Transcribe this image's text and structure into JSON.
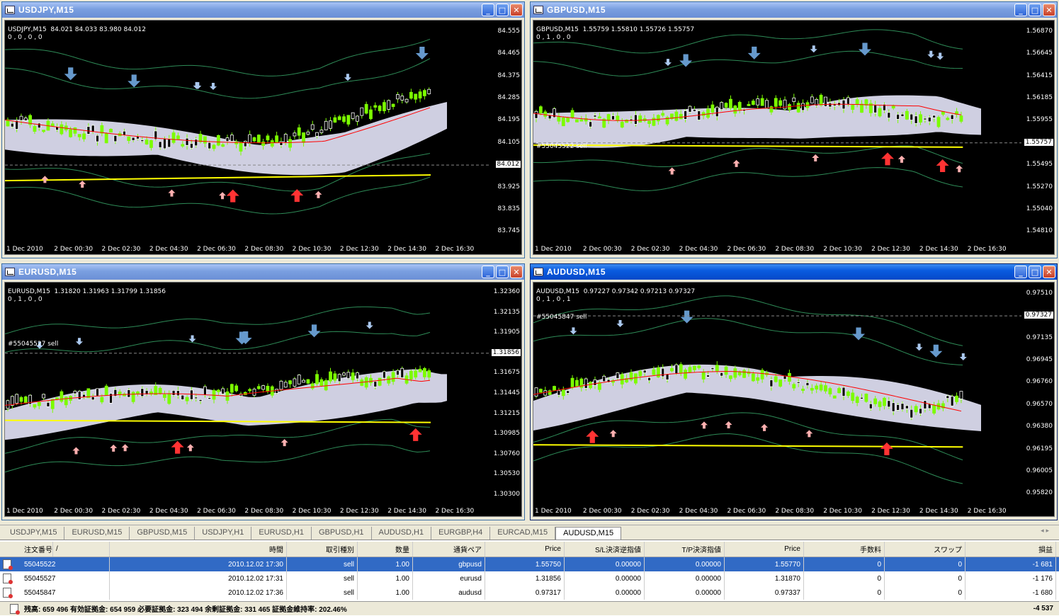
{
  "windows": [
    {
      "id": "usdjpy",
      "title": "USDJPY,M15",
      "info_line1": "USDJPY,M15  84.021 84.033 83.980 84.012",
      "info_line2": "0 , 0 , 0 , 0",
      "price_ticks": [
        "84.555",
        "84.465",
        "84.375",
        "84.285",
        "84.195",
        "84.105",
        "84.012",
        "83.925",
        "83.835",
        "83.745"
      ],
      "current_price": "84.012",
      "order_label": "",
      "time_ticks": [
        "1 Dec 2010",
        "2 Dec 00:30",
        "2 Dec 02:30",
        "2 Dec 04:30",
        "2 Dec 06:30",
        "2 Dec 08:30",
        "2 Dec 10:30",
        "2 Dec 12:30",
        "2 Dec 14:30",
        "2 Dec 16:30"
      ]
    },
    {
      "id": "gbpusd",
      "title": "GBPUSD,M15",
      "info_line1": "GBPUSD,M15  1.55759 1.55810 1.55726 1.55757",
      "info_line2": "0 , 1 , 0 , 0",
      "price_ticks": [
        "1.56870",
        "1.56645",
        "1.56415",
        "1.56185",
        "1.55955",
        "1.55757",
        "1.55495",
        "1.55270",
        "1.55040",
        "1.54810"
      ],
      "current_price": "1.55757",
      "order_label": "#55045522 sell",
      "time_ticks": [
        "1 Dec 2010",
        "2 Dec 00:30",
        "2 Dec 02:30",
        "2 Dec 04:30",
        "2 Dec 06:30",
        "2 Dec 08:30",
        "2 Dec 10:30",
        "2 Dec 12:30",
        "2 Dec 14:30",
        "2 Dec 16:30"
      ]
    },
    {
      "id": "eurusd",
      "title": "EURUSD,M15",
      "info_line1": "EURUSD,M15  1.31820 1.31963 1.31799 1.31856",
      "info_line2": "0 , 1 , 0 , 0",
      "price_ticks": [
        "1.32360",
        "1.32135",
        "1.31905",
        "1.31856",
        "1.31675",
        "1.31445",
        "1.31215",
        "1.30985",
        "1.30760",
        "1.30530",
        "1.30300"
      ],
      "current_price": "1.31856",
      "order_label": "#55045527 sell",
      "time_ticks": [
        "1 Dec 2010",
        "2 Dec 00:30",
        "2 Dec 02:30",
        "2 Dec 04:30",
        "2 Dec 06:30",
        "2 Dec 08:30",
        "2 Dec 10:30",
        "2 Dec 12:30",
        "2 Dec 14:30",
        "2 Dec 16:30"
      ]
    },
    {
      "id": "audusd",
      "title": "AUDUSD,M15",
      "info_line1": "AUDUSD,M15  0.97227 0.97342 0.97213 0.97327",
      "info_line2": "0 , 1 , 0 , 1",
      "price_ticks": [
        "0.97510",
        "0.97327",
        "0.97135",
        "0.96945",
        "0.96760",
        "0.96570",
        "0.96380",
        "0.96195",
        "0.96005",
        "0.95820"
      ],
      "current_price": "0.97327",
      "order_label": "#55045847 sell",
      "time_ticks": [
        "1 Dec 2010",
        "2 Dec 00:30",
        "2 Dec 02:30",
        "2 Dec 04:30",
        "2 Dec 06:30",
        "2 Dec 08:30",
        "2 Dec 10:30",
        "2 Dec 12:30",
        "2 Dec 14:30",
        "2 Dec 16:30"
      ]
    }
  ],
  "tabs": [
    "USDJPY,M15",
    "EURUSD,M15",
    "GBPUSD,M15",
    "USDJPY,H1",
    "EURUSD,H1",
    "GBPUSD,H1",
    "AUDUSD,H1",
    "EURGBP,H4",
    "EURCAD,M15",
    "AUDUSD,M15"
  ],
  "active_tab": "AUDUSD,M15",
  "terminal": {
    "headers": [
      "注文番号",
      "/",
      "時間",
      "取引種別",
      "数量",
      "通貨ペア",
      "Price",
      "S/L決済逆指値",
      "T/P決済指値",
      "Price",
      "手数料",
      "スワップ",
      "損益"
    ],
    "rows": [
      [
        "55045522",
        "2010.12.02 17:30",
        "sell",
        "1.00",
        "gbpusd",
        "1.55750",
        "0.00000",
        "0.00000",
        "1.55770",
        "0",
        "0",
        "-1 681"
      ],
      [
        "55045527",
        "2010.12.02 17:31",
        "sell",
        "1.00",
        "eurusd",
        "1.31856",
        "0.00000",
        "0.00000",
        "1.31870",
        "0",
        "0",
        "-1 176"
      ],
      [
        "55045847",
        "2010.12.02 17:36",
        "sell",
        "1.00",
        "audusd",
        "0.97317",
        "0.00000",
        "0.00000",
        "0.97337",
        "0",
        "0",
        "-1 680"
      ]
    ],
    "balance_text": "残高: 659 496  有効証拠金: 654 959  必要証拠金: 323 494  余剰証拠金: 331 465  証拠金維持率: 202.46%",
    "total_pl": "-4 537"
  },
  "colors": {
    "chart_bg": "#000000",
    "bull_candle": "#7cfc00",
    "bear_candle": "#ffffff",
    "cloud": "#e6e6fa",
    "cloud2": "#f5f5dc",
    "channel": "#2e8b57",
    "ma_red": "#ff0000",
    "support_yellow": "#ffff00",
    "down_arrow": "#6699cc",
    "up_arrow": "#ff3333",
    "selected_row": "#316ac5"
  }
}
